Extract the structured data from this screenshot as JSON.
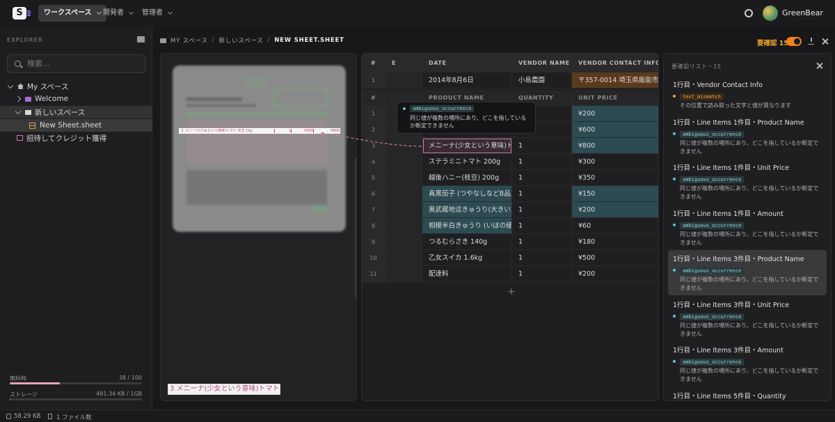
{
  "topbar": {
    "logo": "S",
    "nav": [
      {
        "label": "ワークスペース"
      },
      {
        "label": "開発者"
      },
      {
        "label": "管理者"
      }
    ],
    "user": "GreenBear"
  },
  "sidebar": {
    "title": "EXPLORER",
    "search_placeholder": "検索...",
    "tree": {
      "root": "My スペース",
      "welcome": "Welcome",
      "space": "新しいスペース",
      "sheet": "New Sheet.sheet",
      "invite": "招待してクレジット獲得"
    },
    "usage": {
      "free_label": "無料枠",
      "free_value": "38 / 100",
      "free_fraction": 0.38,
      "storage_label": "ストレージ",
      "storage_value": "481.34 KB / 1GB",
      "storage_fraction": 0.0005
    }
  },
  "breadcrumb": {
    "items": [
      "MY スペース",
      "新しいスペース",
      "NEW SHEET.SHEET"
    ]
  },
  "header": {
    "review_label": "要確認 15",
    "review_toggle_on": true
  },
  "preview": {
    "highlight_row": {
      "num": "3",
      "name": "メニーナ(少女という意味)トマト 中玉 1kg",
      "qty": "1",
      "price": "¥800",
      "amount": "¥800"
    },
    "thumb_text": "3 メニーナ(少女という意味)トマト 中玉 1kg"
  },
  "grid": {
    "head": [
      "#",
      "E",
      "DATE",
      "VENDOR NAME",
      "VENDOR CONTACT INFO"
    ],
    "row1": {
      "num": "1",
      "date": "2014年8月6日",
      "vendor": "小島農園",
      "contact": "〒357-0014 埼玉県飯能市平松"
    },
    "subhead": [
      "#",
      "",
      "PRODUCT NAME",
      "QUANTITY",
      "UNIT PRICE"
    ],
    "rows": [
      {
        "num": "1",
        "name": "",
        "qty": "",
        "price": "¥200"
      },
      {
        "num": "2",
        "name": "",
        "qty": "",
        "price": "¥600"
      },
      {
        "num": "3",
        "name": "メニーナ(少女という意味)トマト",
        "qty": "1",
        "price": "¥800"
      },
      {
        "num": "4",
        "name": "ステラミニトマト 200g",
        "qty": "1",
        "price": "¥300"
      },
      {
        "num": "5",
        "name": "越後ハニー(枝豆) 200g",
        "qty": "1",
        "price": "¥350"
      },
      {
        "num": "6",
        "name": "真黒茄子 (つやなしなどB品入り)",
        "qty": "1",
        "price": "¥150"
      },
      {
        "num": "7",
        "name": "奥武蔵地這きゅうり(大きい方) 3",
        "qty": "1",
        "price": "¥200"
      },
      {
        "num": "8",
        "name": "相模半白きゅうり (いぼの硬い方)",
        "qty": "1",
        "price": "¥60"
      },
      {
        "num": "9",
        "name": "つるむらさき 140g",
        "qty": "1",
        "price": "¥180"
      },
      {
        "num": "10",
        "name": "乙女スイカ 1.6kg",
        "qty": "1",
        "price": "¥500"
      },
      {
        "num": "11",
        "name": "配達料",
        "qty": "1",
        "price": "¥200"
      }
    ],
    "add_row": "+"
  },
  "tooltip": {
    "tag": "ambiguous_occurrence",
    "text": "同じ値が複数の場所にあり、どこを指しているか断定できません"
  },
  "review": {
    "title": "要確認リスト・15",
    "items": [
      {
        "title": "1行目・Vendor Contact Info",
        "tag": "text_mismatch",
        "msg": "その位置で読み取った文字と値が異なります"
      },
      {
        "title": "1行目・Line Items 1件目・Product Name",
        "tag": "ambiguous_occurrence",
        "msg": "同じ値が複数の場所にあり、どこを指しているか断定できません"
      },
      {
        "title": "1行目・Line Items 1件目・Unit Price",
        "tag": "ambiguous_occurrence",
        "msg": "同じ値が複数の場所にあり、どこを指しているか断定できません"
      },
      {
        "title": "1行目・Line Items 1件目・Amount",
        "tag": "ambiguous_occurrence",
        "msg": "同じ値が複数の場所にあり、どこを指しているか断定できません"
      },
      {
        "title": "1行目・Line Items 3件目・Product Name",
        "tag": "ambiguous_occurrence",
        "msg": "同じ値が複数の場所にあり、どこを指しているか断定できません"
      },
      {
        "title": "1行目・Line Items 3件目・Unit Price",
        "tag": "ambiguous_occurrence",
        "msg": "同じ値が複数の場所にあり、どこを指しているか断定できません"
      },
      {
        "title": "1行目・Line Items 3件目・Amount",
        "tag": "ambiguous_occurrence",
        "msg": "同じ値が複数の場所にあり、どこを指しているか断定できません"
      },
      {
        "title": "1行目・Line Items 5件目・Quantity",
        "tag": "ambiguous_occurrence",
        "msg": ""
      }
    ]
  },
  "statusbar": {
    "size": "58.29 KB",
    "files": "1 ファイル数"
  },
  "colors": {
    "accent_orange": "#f0821e",
    "usage_pink": "#e8a2c0",
    "teal_cell": "#2c4b52",
    "folder_purple": "#a86ed8"
  }
}
